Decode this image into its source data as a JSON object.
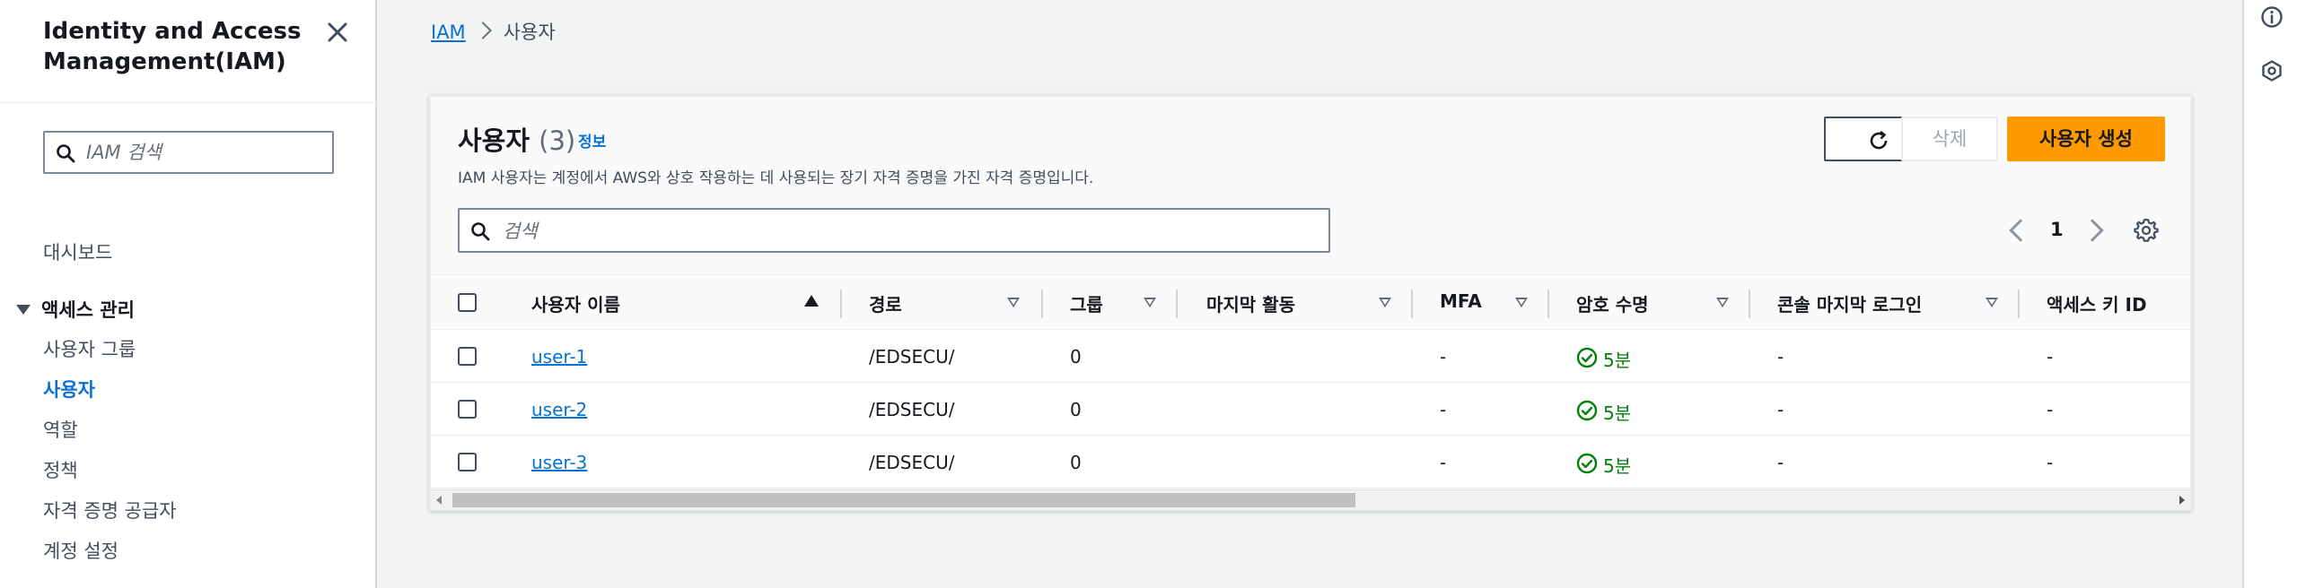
{
  "sidebar": {
    "title": "Identity and Access Management(IAM)",
    "search_placeholder": "IAM 검색",
    "dashboard": "대시보드",
    "section_access": "액세스 관리",
    "items": [
      {
        "label": "사용자 그룹"
      },
      {
        "label": "사용자"
      },
      {
        "label": "역할"
      },
      {
        "label": "정책"
      },
      {
        "label": "자격 증명 공급자"
      },
      {
        "label": "계정 설정"
      }
    ]
  },
  "breadcrumb": {
    "root": "IAM",
    "current": "사용자"
  },
  "header": {
    "title": "사용자",
    "count": "(3)",
    "info": "정보",
    "description": "IAM 사용자는 계정에서 AWS와 상호 작용하는 데 사용되는 장기 자격 증명을 가진 자격 증명입니다."
  },
  "actions": {
    "delete": "삭제",
    "create": "사용자 생성"
  },
  "table_search_placeholder": "검색",
  "pagination": {
    "page": "1"
  },
  "table": {
    "columns": [
      "사용자 이름",
      "경로",
      "그룹",
      "마지막 활동",
      "MFA",
      "암호 수명",
      "콘솔 마지막 로그인",
      "액세스 키 ID"
    ],
    "rows": [
      {
        "name": "user-1",
        "path": "/EDSECU/",
        "groups": "0",
        "last_activity": "",
        "mfa": "-",
        "password_age": "5분",
        "console_last_login": "-",
        "access_key": "-"
      },
      {
        "name": "user-2",
        "path": "/EDSECU/",
        "groups": "0",
        "last_activity": "",
        "mfa": "-",
        "password_age": "5분",
        "console_last_login": "-",
        "access_key": "-"
      },
      {
        "name": "user-3",
        "path": "/EDSECU/",
        "groups": "0",
        "last_activity": "",
        "mfa": "-",
        "password_age": "5분",
        "console_last_login": "-",
        "access_key": "-"
      }
    ]
  },
  "colors": {
    "accent": "#0972d3",
    "primary_button": "#ff9900",
    "success": "#037f0c"
  },
  "icons": [
    "close-icon",
    "search-icon",
    "refresh-icon",
    "chevron-left-icon",
    "chevron-right-icon",
    "gear-icon",
    "check-circle-icon",
    "info-icon",
    "feedback-icon"
  ]
}
